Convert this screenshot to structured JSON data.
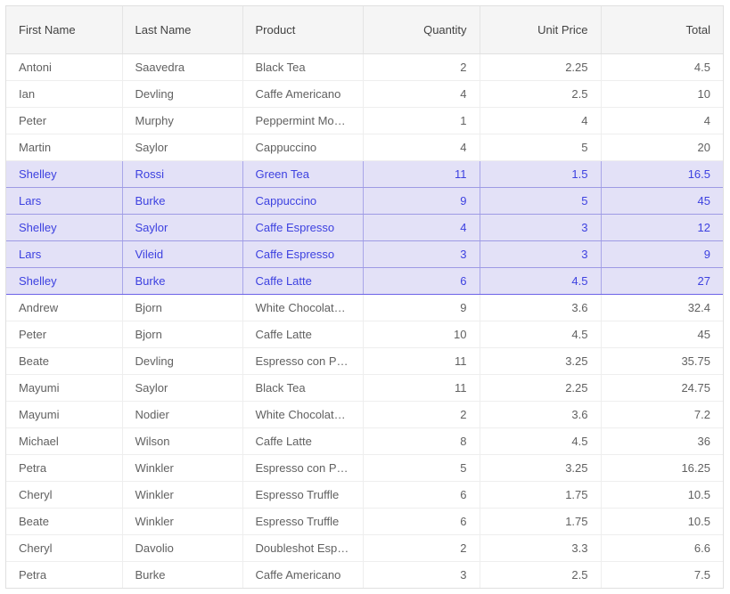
{
  "grid": {
    "columns": [
      {
        "key": "first_name",
        "label": "First Name",
        "align": "left"
      },
      {
        "key": "last_name",
        "label": "Last Name",
        "align": "left"
      },
      {
        "key": "product",
        "label": "Product",
        "align": "left"
      },
      {
        "key": "quantity",
        "label": "Quantity",
        "align": "right"
      },
      {
        "key": "unit_price",
        "label": "Unit Price",
        "align": "right"
      },
      {
        "key": "total",
        "label": "Total",
        "align": "right"
      }
    ],
    "rows": [
      {
        "first_name": "Antoni",
        "last_name": "Saavedra",
        "product": "Black Tea",
        "quantity": "2",
        "unit_price": "2.25",
        "total": "4.5",
        "selected": false
      },
      {
        "first_name": "Ian",
        "last_name": "Devling",
        "product": "Caffe Americano",
        "quantity": "4",
        "unit_price": "2.5",
        "total": "10",
        "selected": false
      },
      {
        "first_name": "Peter",
        "last_name": "Murphy",
        "product": "Peppermint Mocha Twist",
        "quantity": "1",
        "unit_price": "4",
        "total": "4",
        "selected": false
      },
      {
        "first_name": "Martin",
        "last_name": "Saylor",
        "product": "Cappuccino",
        "quantity": "4",
        "unit_price": "5",
        "total": "20",
        "selected": false
      },
      {
        "first_name": "Shelley",
        "last_name": "Rossi",
        "product": "Green Tea",
        "quantity": "11",
        "unit_price": "1.5",
        "total": "16.5",
        "selected": true
      },
      {
        "first_name": "Lars",
        "last_name": "Burke",
        "product": "Cappuccino",
        "quantity": "9",
        "unit_price": "5",
        "total": "45",
        "selected": true
      },
      {
        "first_name": "Shelley",
        "last_name": "Saylor",
        "product": "Caffe Espresso",
        "quantity": "4",
        "unit_price": "3",
        "total": "12",
        "selected": true
      },
      {
        "first_name": "Lars",
        "last_name": "Vileid",
        "product": "Caffe Espresso",
        "quantity": "3",
        "unit_price": "3",
        "total": "9",
        "selected": true
      },
      {
        "first_name": "Shelley",
        "last_name": "Burke",
        "product": "Caffe Latte",
        "quantity": "6",
        "unit_price": "4.5",
        "total": "27",
        "selected": true
      },
      {
        "first_name": "Andrew",
        "last_name": "Bjorn",
        "product": "White Chocolate Mocha",
        "quantity": "9",
        "unit_price": "3.6",
        "total": "32.4",
        "selected": false
      },
      {
        "first_name": "Peter",
        "last_name": "Bjorn",
        "product": "Caffe Latte",
        "quantity": "10",
        "unit_price": "4.5",
        "total": "45",
        "selected": false
      },
      {
        "first_name": "Beate",
        "last_name": "Devling",
        "product": "Espresso con Panna",
        "quantity": "11",
        "unit_price": "3.25",
        "total": "35.75",
        "selected": false
      },
      {
        "first_name": "Mayumi",
        "last_name": "Saylor",
        "product": "Black Tea",
        "quantity": "11",
        "unit_price": "2.25",
        "total": "24.75",
        "selected": false
      },
      {
        "first_name": "Mayumi",
        "last_name": "Nodier",
        "product": "White Chocolate Mocha",
        "quantity": "2",
        "unit_price": "3.6",
        "total": "7.2",
        "selected": false
      },
      {
        "first_name": "Michael",
        "last_name": "Wilson",
        "product": "Caffe Latte",
        "quantity": "8",
        "unit_price": "4.5",
        "total": "36",
        "selected": false
      },
      {
        "first_name": "Petra",
        "last_name": "Winkler",
        "product": "Espresso con Panna",
        "quantity": "5",
        "unit_price": "3.25",
        "total": "16.25",
        "selected": false
      },
      {
        "first_name": "Cheryl",
        "last_name": "Winkler",
        "product": "Espresso Truffle",
        "quantity": "6",
        "unit_price": "1.75",
        "total": "10.5",
        "selected": false
      },
      {
        "first_name": "Beate",
        "last_name": "Winkler",
        "product": "Espresso Truffle",
        "quantity": "6",
        "unit_price": "1.75",
        "total": "10.5",
        "selected": false
      },
      {
        "first_name": "Cheryl",
        "last_name": "Davolio",
        "product": "Doubleshot Espresso",
        "quantity": "2",
        "unit_price": "3.3",
        "total": "6.6",
        "selected": false
      },
      {
        "first_name": "Petra",
        "last_name": "Burke",
        "product": "Caffe Americano",
        "quantity": "3",
        "unit_price": "2.5",
        "total": "7.5",
        "selected": false
      }
    ]
  },
  "colors": {
    "header_background": "#f5f5f5",
    "header_text": "#424242",
    "cell_text": "#616161",
    "row_border": "#eeeeee",
    "selected_background": "#e3e1f7",
    "selected_text": "#3d41e0",
    "selected_edge": "#6c63e8"
  }
}
